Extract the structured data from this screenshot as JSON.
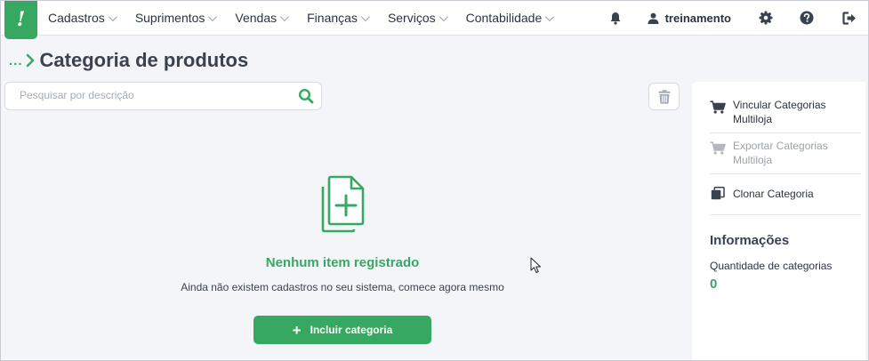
{
  "brand": {
    "logo_glyph": "!",
    "color": "#37a862"
  },
  "nav": {
    "items": [
      {
        "label": "Cadastros"
      },
      {
        "label": "Suprimentos"
      },
      {
        "label": "Vendas"
      },
      {
        "label": "Finanças"
      },
      {
        "label": "Serviços"
      },
      {
        "label": "Contabilidade"
      }
    ],
    "user": "treinamento",
    "icons": [
      "bell-icon",
      "user-icon",
      "gear-icon",
      "help-icon",
      "logout-icon"
    ]
  },
  "page": {
    "breadcrumb": "...",
    "title": "Categoria de produtos"
  },
  "search": {
    "placeholder": "Pesquisar por descrição",
    "value": ""
  },
  "empty_state": {
    "title": "Nenhum item registrado",
    "subtitle": "Ainda não existem cadastros no seu sistema, comece agora mesmo",
    "button": "Incluir categoria"
  },
  "side_panel": {
    "actions": [
      {
        "label": "Vincular Categorias Multiloja",
        "enabled": true,
        "icon": "cart-icon"
      },
      {
        "label": "Exportar Categorias Multiloja",
        "enabled": false,
        "icon": "cart-icon"
      },
      {
        "label": "Clonar Categoria",
        "enabled": true,
        "icon": "clone-icon"
      }
    ],
    "info_title": "Informações",
    "info_label": "Quantidade de categorias",
    "info_value": "0"
  },
  "colors": {
    "accent": "#37a862",
    "text": "#3a4250",
    "muted": "#9ca2ab",
    "background": "#f4f5f8"
  }
}
